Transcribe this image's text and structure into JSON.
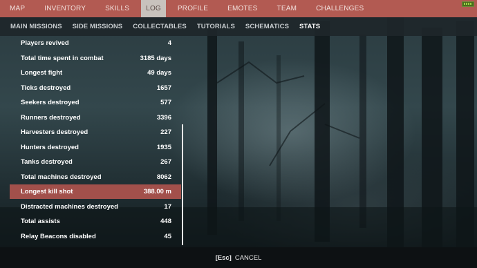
{
  "top_nav": {
    "tabs": [
      {
        "label": "MAP"
      },
      {
        "label": "INVENTORY"
      },
      {
        "label": "SKILLS"
      },
      {
        "label": "LOG"
      },
      {
        "label": "PROFILE"
      },
      {
        "label": "EMOTES"
      },
      {
        "label": "TEAM"
      },
      {
        "label": "CHALLENGES"
      }
    ],
    "active": "LOG"
  },
  "sub_nav": {
    "tabs": [
      {
        "label": "MAIN MISSIONS"
      },
      {
        "label": "SIDE MISSIONS"
      },
      {
        "label": "COLLECTABLES"
      },
      {
        "label": "TUTORIALS"
      },
      {
        "label": "SCHEMATICS"
      },
      {
        "label": "STATS"
      }
    ],
    "active": "STATS"
  },
  "stats": [
    {
      "label": "Players revived",
      "value": "4"
    },
    {
      "label": "Total time spent in combat",
      "value": "3185 days"
    },
    {
      "label": "Longest fight",
      "value": "49 days"
    },
    {
      "label": "Ticks destroyed",
      "value": "1657"
    },
    {
      "label": "Seekers destroyed",
      "value": "577"
    },
    {
      "label": "Runners destroyed",
      "value": "3396"
    },
    {
      "label": "Harvesters destroyed",
      "value": "227"
    },
    {
      "label": "Hunters destroyed",
      "value": "1935"
    },
    {
      "label": "Tanks destroyed",
      "value": "267"
    },
    {
      "label": "Total machines destroyed",
      "value": "8062"
    },
    {
      "label": "Longest kill shot",
      "value": "388.00 m",
      "selected": true
    },
    {
      "label": "Distracted machines destroyed",
      "value": "17"
    },
    {
      "label": "Total assists",
      "value": "448"
    },
    {
      "label": "Relay Beacons disabled",
      "value": "45"
    }
  ],
  "bottom_bar": {
    "key_hint": "[Esc]",
    "action": "CANCEL"
  },
  "colors": {
    "nav_accent": "#b25a52",
    "selected_row": "#a2504b",
    "active_tab_bg": "#c8c2bd",
    "battery": "#9bd147"
  },
  "icons": [
    "battery-icon"
  ]
}
